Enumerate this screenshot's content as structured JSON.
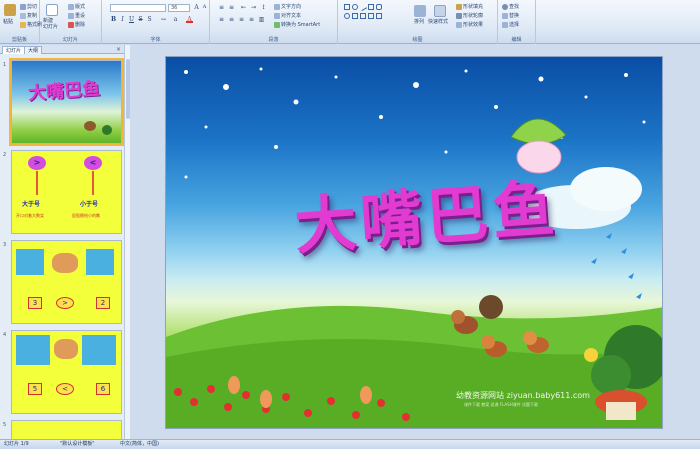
{
  "ribbon": {
    "clipboard": {
      "label": "剪贴板",
      "paste": "粘贴",
      "cut": "剪切",
      "copy": "复制",
      "format_painter": "格式刷"
    },
    "slides": {
      "label": "幻灯片",
      "new_slide": "新建\n幻灯片",
      "layout": "版式",
      "reset": "重设",
      "delete": "删除"
    },
    "font": {
      "label": "字体",
      "font_name": "",
      "font_size": "36"
    },
    "paragraph": {
      "label": "段落",
      "text_direction": "文字方向",
      "align_text": "对齐文本",
      "convert_smartart": "转换为 SmartArt"
    },
    "drawing": {
      "label": "绘图",
      "arrange": "排列",
      "quick_styles": "快速样式",
      "shape_fill": "形状填充",
      "shape_outline": "形状轮廓",
      "shape_effects": "形状效果"
    },
    "editing": {
      "label": "编辑",
      "find": "查找",
      "replace": "替换",
      "select": "选择"
    }
  },
  "panel": {
    "tab_slides": "幻灯片",
    "tab_outline": "大纲",
    "close": "×",
    "slides": [
      {
        "num": "1",
        "title": "大嘴巴鱼"
      },
      {
        "num": "2",
        "sym_left": ">",
        "sym_right": "<",
        "label_left": "大于号",
        "label_right": "小于号",
        "caption_left": "开口对着大数笑",
        "caption_right": "屁股撅给小的瞧"
      },
      {
        "num": "3",
        "num_left": "3",
        "sym": ">",
        "num_right": "2"
      },
      {
        "num": "4",
        "num_left": "5",
        "sym": "<",
        "num_right": "6"
      },
      {
        "num": "5"
      }
    ]
  },
  "slide": {
    "title": "大嘴巴鱼",
    "watermark": "幼教资源网站 ziyuan.baby611.com",
    "watermark_sub": "课件下载 教案 说课 FLASH课件 试题下载"
  },
  "statusbar": {
    "slide_info": "幻灯片 1/9",
    "theme": "\"默认设计模板\"",
    "language": "中文(简体，中国)"
  },
  "colors": {
    "title": "#e23bd2",
    "ribbon_bg": "#dde8f5",
    "thumb_yellow": "#f2ff3a",
    "select_outline": "#f2b63a"
  }
}
